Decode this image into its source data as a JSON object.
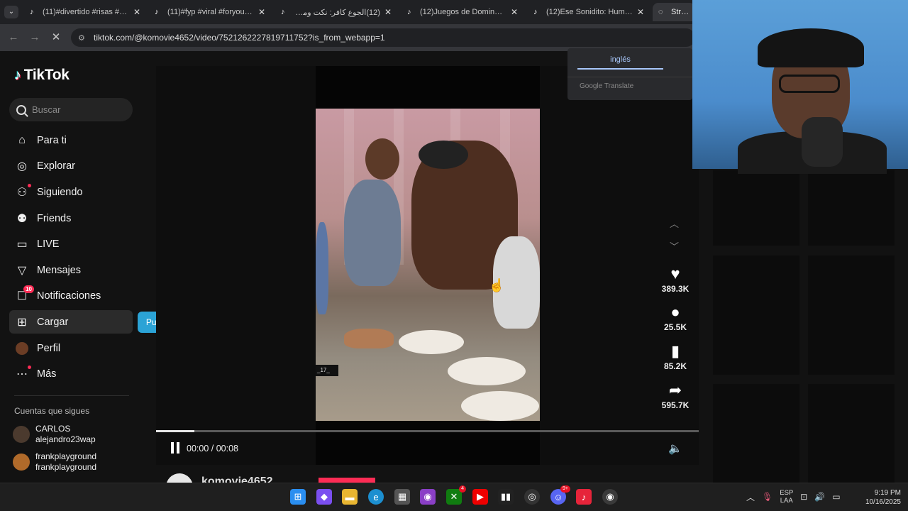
{
  "browser": {
    "tabs": [
      {
        "title": "(11)#divertido #risas #com",
        "favicon": "tiktok-icon"
      },
      {
        "title": "(11)#fyp #viral #foryoupag",
        "favicon": "tiktok-icon"
      },
      {
        "title": "(12)الجوع كافر: نكت ومواقف",
        "favicon": "tiktok-icon"
      },
      {
        "title": "(12)Juegos de Domino Don",
        "favicon": "tiktok-icon"
      },
      {
        "title": "(12)Ese Sonidito: Humor D",
        "favicon": "tiktok-icon"
      },
      {
        "title": "Street",
        "favicon": "globe-icon"
      }
    ],
    "url": "tiktok.com/@komovie4652/video/7521262227819711752?is_from_webapp=1"
  },
  "sidebar": {
    "logo": "TikTok",
    "search_placeholder": "Buscar",
    "items": [
      {
        "label": "Para ti",
        "icon": "home-icon"
      },
      {
        "label": "Explorar",
        "icon": "compass-icon"
      },
      {
        "label": "Siguiendo",
        "icon": "following-icon"
      },
      {
        "label": "Friends",
        "icon": "friends-icon"
      },
      {
        "label": "LIVE",
        "icon": "live-icon"
      },
      {
        "label": "Mensajes",
        "icon": "messages-icon"
      },
      {
        "label": "Notificaciones",
        "icon": "notifications-icon",
        "badge": "10"
      },
      {
        "label": "Cargar",
        "icon": "upload-icon"
      },
      {
        "label": "Perfil",
        "icon": "profile-avatar"
      },
      {
        "label": "Más",
        "icon": "more-icon"
      }
    ],
    "upload_tooltip": "Publicar video",
    "following_title": "Cuentas que sigues",
    "following": [
      {
        "name": "CARLOS",
        "handle": "alejandro23wap"
      },
      {
        "name": "frankplayground",
        "handle": "frankplayground"
      }
    ]
  },
  "video": {
    "watermark": "_17_",
    "time": "00:00 / 00:08",
    "progress": 0.07,
    "author": "komovie4652"
  },
  "actions": {
    "likes": "389.3K",
    "comments": "25.5K",
    "saves": "85.2K",
    "shares": "595.7K"
  },
  "translate": {
    "language": "inglés",
    "provider": "Google Translate"
  },
  "taskbar": {
    "lang_line1": "ESP",
    "lang_line2": "LAA",
    "time": "9:19 PM",
    "date": "10/16/2025",
    "badges": {
      "xbox": "4",
      "discord": "9+"
    }
  }
}
